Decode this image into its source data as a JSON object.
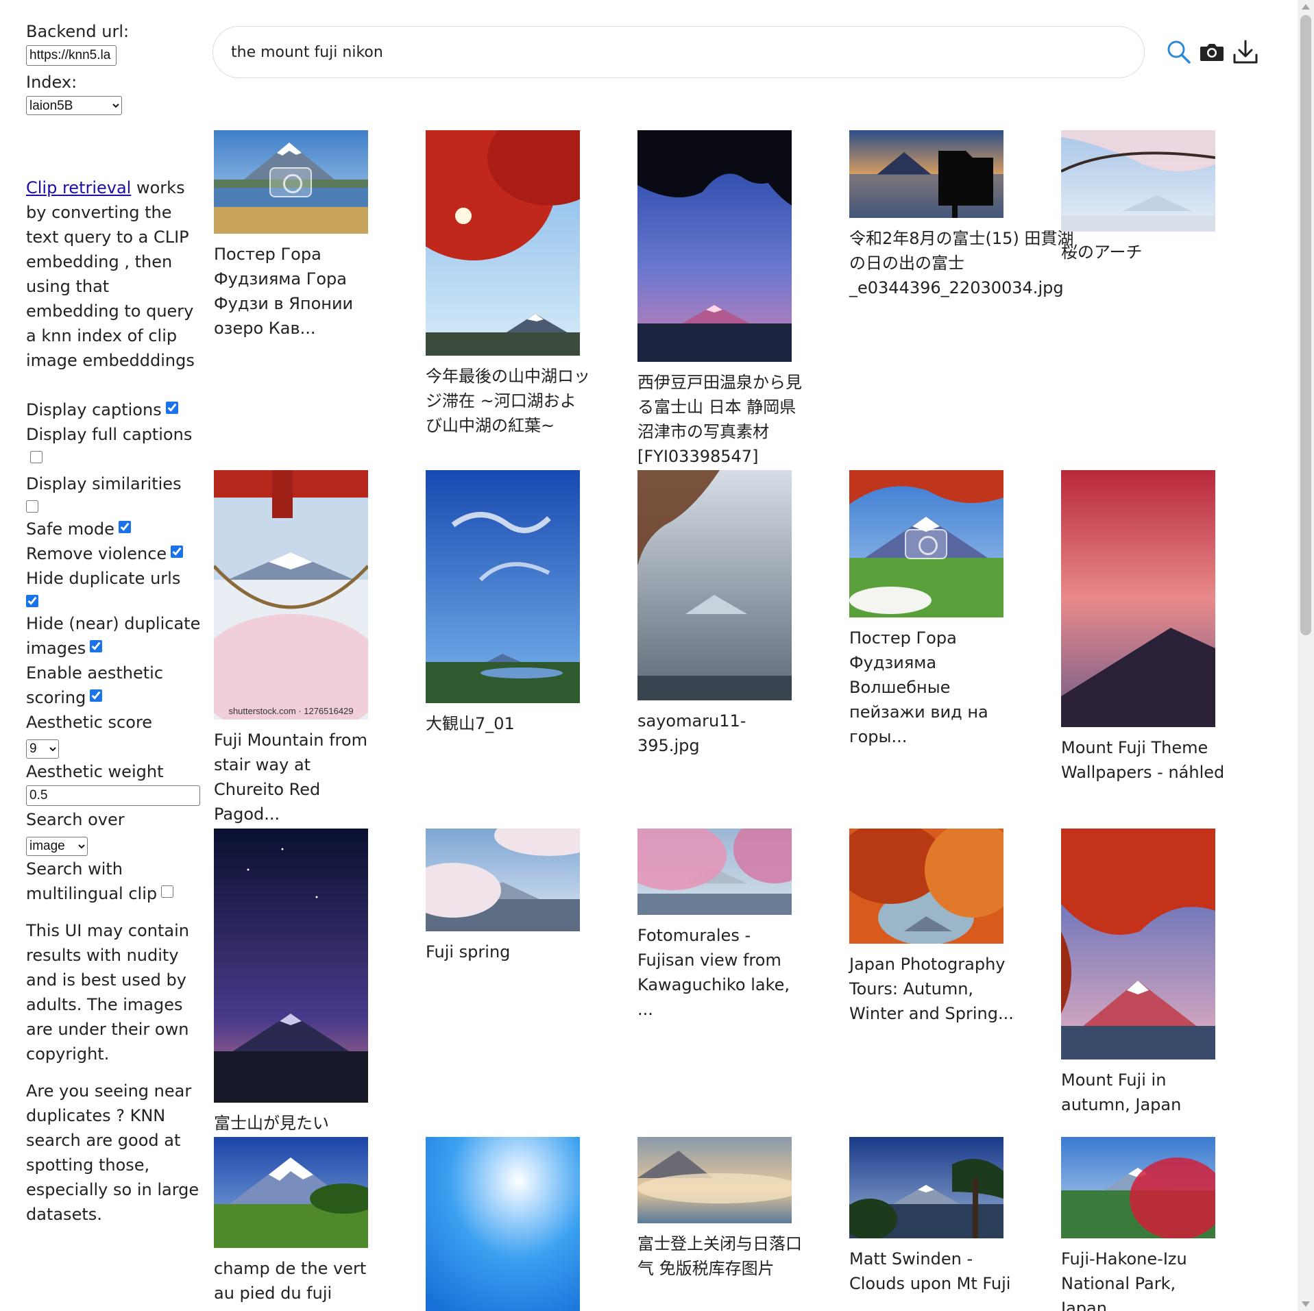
{
  "sidebar": {
    "backend_label": "Backend url:",
    "backend_value": "https://knn5.la",
    "index_label": "Index:",
    "index_value": "laion5B",
    "intro_link": "Clip retrieval",
    "intro_text": " works by converting the text query to a CLIP embedding , then using that embedding to query a knn index of clip image embedddings",
    "options": {
      "display_captions": "Display captions",
      "display_full_captions": "Display full captions",
      "display_similarities": "Display similarities",
      "safe_mode": "Safe mode",
      "remove_violence": "Remove violence",
      "hide_duplicate_urls": "Hide duplicate urls",
      "hide_near_duplicates": "Hide (near) duplicate images",
      "enable_aesthetic": "Enable aesthetic scoring",
      "aesthetic_score_label": "Aesthetic score",
      "aesthetic_score_value": "9",
      "aesthetic_weight_label": "Aesthetic weight",
      "aesthetic_weight_value": "0.5",
      "search_over_label": "Search over",
      "search_over_value": "image",
      "multilingual_label": "Search with multilingual clip"
    },
    "disclaimer": "This UI may contain results with nudity and is best used by adults. The images are under their own copyright.",
    "duplicates_note": "Are you seeing near duplicates ? KNN search are good at spotting those, especially so in large datasets."
  },
  "search": {
    "query": "the mount fuji nikon"
  },
  "icons": {
    "search": "search-icon",
    "camera": "camera-icon",
    "download": "download-icon"
  },
  "colors": {
    "link": "#1a0dab",
    "accent": "#1a73e8",
    "search_icon": "#2c8ad8"
  },
  "results": [
    {
      "caption": "Постер Гора Фудзияма Гора Фудзи в Японии озеро Кав..."
    },
    {
      "caption": "今年最後の山中湖ロッジ滞在 ~河口湖および山中湖の紅葉~"
    },
    {
      "caption": "西伊豆戸田温泉から見る富士山 日本 静岡県 沼津市の写真素材 [FYI03398547]"
    },
    {
      "caption": "令和2年8月の富士(15) 田貫湖の日の出の富士_e0344396_22030034.jpg"
    },
    {
      "caption": "桜のアーチ"
    },
    {
      "caption": "Fuji Mountain from stair way at Chureito Red Pagod...",
      "stock": "shutterstock.com · 1276516429"
    },
    {
      "caption": "大観山7_01"
    },
    {
      "caption": "sayomaru11-395.jpg"
    },
    {
      "caption": "Постер Гора Фудзияма Волшебные пейзажи вид на горы..."
    },
    {
      "caption": "Mount Fuji Theme Wallpapers - náhled"
    },
    {
      "caption": "富士山が見たい"
    },
    {
      "caption": "Fuji spring"
    },
    {
      "caption": "Fotomurales - Fujisan view from Kawaguchiko lake, ..."
    },
    {
      "caption": "Japan Photography Tours: Autumn, Winter and Spring..."
    },
    {
      "caption": "Mount Fuji in autumn, Japan"
    },
    {
      "caption": "champ de the vert au pied du fuji"
    },
    {
      "caption": ""
    },
    {
      "caption": "富士登上关闭与日落口气 免版税库存图片"
    },
    {
      "caption": "Matt Swinden - Clouds upon Mt Fuji"
    },
    {
      "caption": "Fuji-Hakone-Izu National Park, Japan"
    }
  ]
}
